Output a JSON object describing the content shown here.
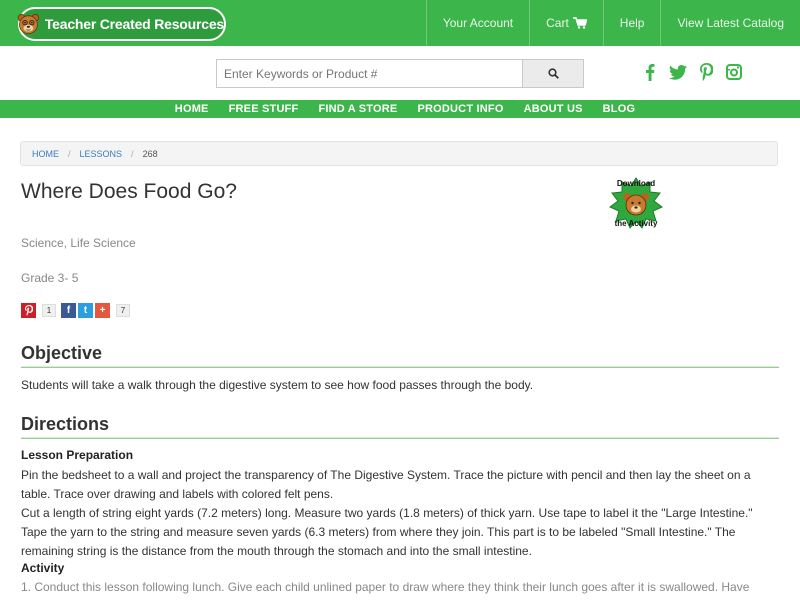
{
  "header": {
    "logo_text": "Teacher Created Resources",
    "nav": {
      "account": "Your Account",
      "cart": "Cart",
      "help": "Help",
      "catalog": "View Latest Catalog"
    },
    "brand_color": "#3cb54a"
  },
  "search": {
    "placeholder": "Enter Keywords or Product #",
    "button_icon": "search-icon"
  },
  "social_icons": [
    "facebook-icon",
    "twitter-icon",
    "pinterest-icon",
    "instagram-icon"
  ],
  "main_nav": {
    "home": "HOME",
    "free_stuff": "FREE STUFF",
    "find_store": "FIND A STORE",
    "product_info": "PRODUCT INFO",
    "about_us": "ABOUT US",
    "blog": "BLOG"
  },
  "breadcrumb": {
    "home": "HOME",
    "lessons": "LESSONS",
    "current": "268",
    "separator": "/"
  },
  "lesson": {
    "title": "Where Does Food Go?",
    "subject": "Science, Life Science",
    "grade": "Grade 3- 5",
    "download": {
      "line1": "Download",
      "line2": "the Activity"
    },
    "share": {
      "pinterest_count": "1",
      "facebook_letter": "f",
      "twitter_letter": "t",
      "google_letter": "+",
      "total_count": "7"
    },
    "objective_heading": "Objective",
    "objective_text": "Students will take a walk through the digestive system to see how food passes through the body.",
    "directions_heading": "Directions",
    "lesson_prep_heading": "Lesson Preparation",
    "prep_p1": "Pin the bedsheet to a wall and project the transparency of The Digestive System. Trace the picture with pencil and then lay the sheet on a table. Trace over drawing and labels with colored felt pens.",
    "prep_p2": "Cut a length of string eight yards (7.2 meters) long. Measure two yards (1.8 meters) of thick yarn. Use tape to label it the \"Large Intestine.\" Tape the yarn to the string and measure seven yards (6.3 meters) from where they join. This part is to be labeled \"Small Intestine.\" The remaining string is the distance from the mouth through the stomach and into the small intestine.",
    "activity_heading": "Activity",
    "activity_1": "1.  Conduct this lesson following lunch. Give each child unlined paper to draw where they think their lunch goes after it is swallowed. Have"
  }
}
